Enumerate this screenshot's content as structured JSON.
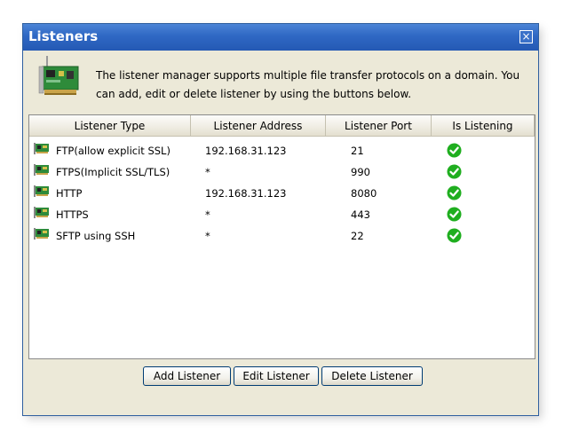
{
  "window": {
    "title": "Listeners",
    "close_label": "×",
    "description": "The listener manager supports multiple file transfer protocols on a domain. You can add, edit or delete listener by using the buttons below."
  },
  "table": {
    "columns": [
      "Listener Type",
      "Listener Address",
      "Listener Port",
      "Is Listening"
    ],
    "rows": [
      {
        "type": "FTP(allow explicit SSL)",
        "address": "192.168.31.123",
        "port": "21",
        "listening": true
      },
      {
        "type": "FTPS(Implicit SSL/TLS)",
        "address": "*",
        "port": "990",
        "listening": true
      },
      {
        "type": "HTTP",
        "address": "192.168.31.123",
        "port": "8080",
        "listening": true
      },
      {
        "type": "HTTPS",
        "address": "*",
        "port": "443",
        "listening": true
      },
      {
        "type": "SFTP using SSH",
        "address": "*",
        "port": "22",
        "listening": true
      }
    ]
  },
  "buttons": {
    "add": "Add Listener",
    "edit": "Edit Listener",
    "delete": "Delete Listener"
  },
  "icons": {
    "header": "network-card-icon",
    "row": "network-adapter-icon",
    "status": "green-check-icon",
    "close": "close-icon"
  },
  "colors": {
    "titlebar": "#2f68c4",
    "dialog_bg": "#ece9d8",
    "check_green": "#1fae1f"
  }
}
